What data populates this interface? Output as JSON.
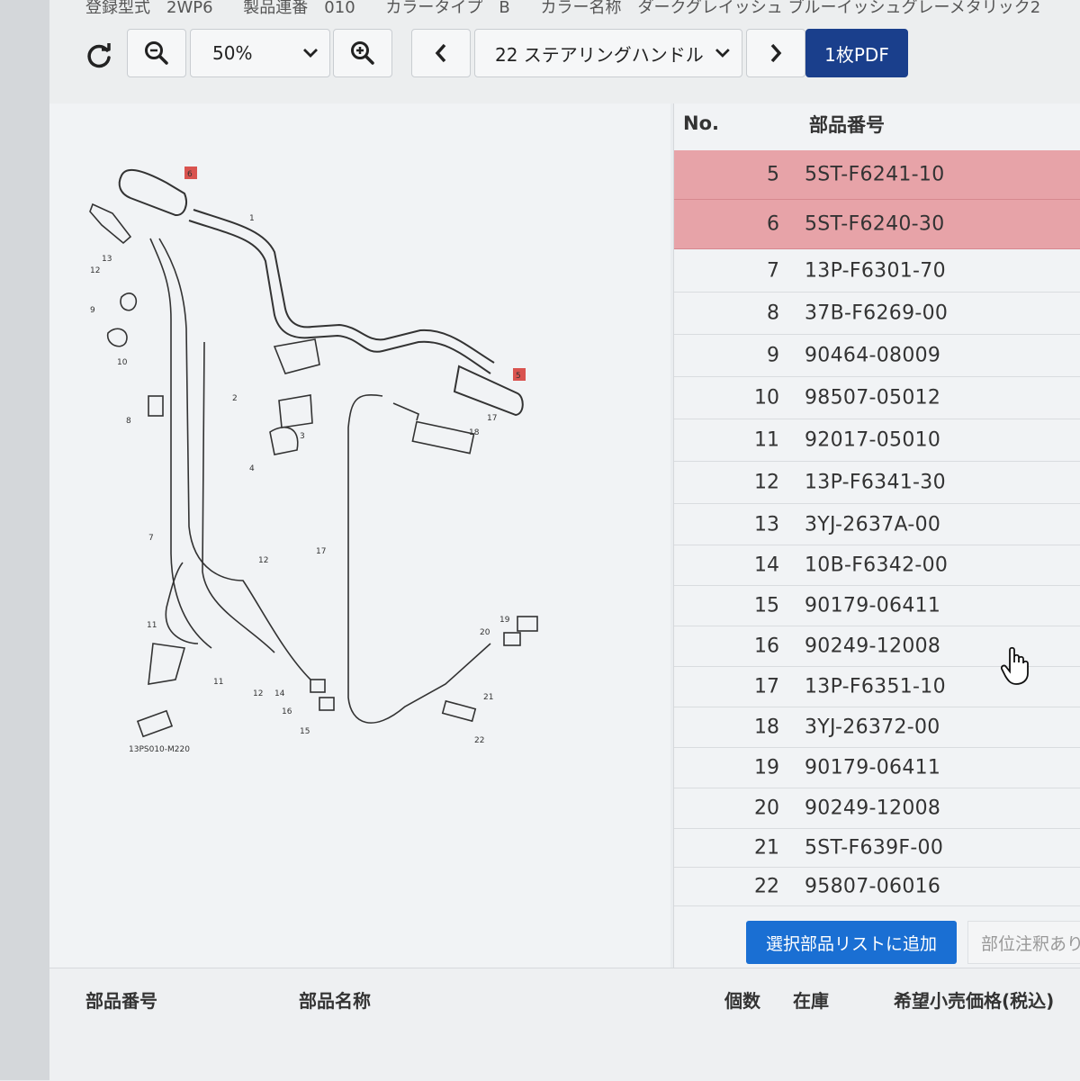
{
  "header": {
    "meta": [
      "登録型式　2WP6",
      "製品連番　010",
      "カラータイプ　B",
      "カラー名称　ダークグレイッシュ ブルーイッシュグレーメタリック2"
    ],
    "zoom": "50%",
    "section": "22 ステアリングハンドル",
    "pdf_label": "1枚PDF"
  },
  "diagram": {
    "code": "13PS010-M220",
    "callouts": [
      "1",
      "2",
      "3",
      "4",
      "5",
      "6",
      "7",
      "8",
      "9",
      "10",
      "11",
      "11",
      "12",
      "12",
      "12",
      "13",
      "14",
      "15",
      "16",
      "17",
      "17",
      "18",
      "19",
      "20",
      "21",
      "22"
    ]
  },
  "parts": {
    "col_no": "No.",
    "col_pn": "部品番号",
    "rows": [
      {
        "no": "5",
        "pn": "5ST-F6241-10",
        "highlighted": true
      },
      {
        "no": "6",
        "pn": "5ST-F6240-30",
        "highlighted": true
      },
      {
        "no": "7",
        "pn": "13P-F6301-70",
        "highlighted": false
      },
      {
        "no": "8",
        "pn": "37B-F6269-00",
        "highlighted": false
      },
      {
        "no": "9",
        "pn": "90464-08009",
        "highlighted": false
      },
      {
        "no": "10",
        "pn": "98507-05012",
        "highlighted": false
      },
      {
        "no": "11",
        "pn": "92017-05010",
        "highlighted": false
      },
      {
        "no": "12",
        "pn": "13P-F6341-30",
        "highlighted": false
      },
      {
        "no": "13",
        "pn": "3YJ-2637A-00",
        "highlighted": false
      },
      {
        "no": "14",
        "pn": "10B-F6342-00",
        "highlighted": false
      },
      {
        "no": "15",
        "pn": "90179-06411",
        "highlighted": false
      },
      {
        "no": "16",
        "pn": "90249-12008",
        "highlighted": false
      },
      {
        "no": "17",
        "pn": "13P-F6351-10",
        "highlighted": false
      },
      {
        "no": "18",
        "pn": "3YJ-26372-00",
        "highlighted": false
      },
      {
        "no": "19",
        "pn": "90179-06411",
        "highlighted": false
      },
      {
        "no": "20",
        "pn": "90249-12008",
        "highlighted": false
      },
      {
        "no": "21",
        "pn": "5ST-F639F-00",
        "highlighted": false
      },
      {
        "no": "22",
        "pn": "95807-06016",
        "highlighted": false
      }
    ],
    "add_label": "選択部品リストに追加",
    "note_label": "部位注釈あり"
  },
  "footer": {
    "part_number": "部品番号",
    "part_name": "部品名称",
    "qty": "個数",
    "stock": "在庫",
    "price": "希望小売価格(税込)"
  },
  "colors": {
    "highlight": "#e7a3a8",
    "primary": "#1a6fd3",
    "pdf": "#1a3f8c"
  }
}
